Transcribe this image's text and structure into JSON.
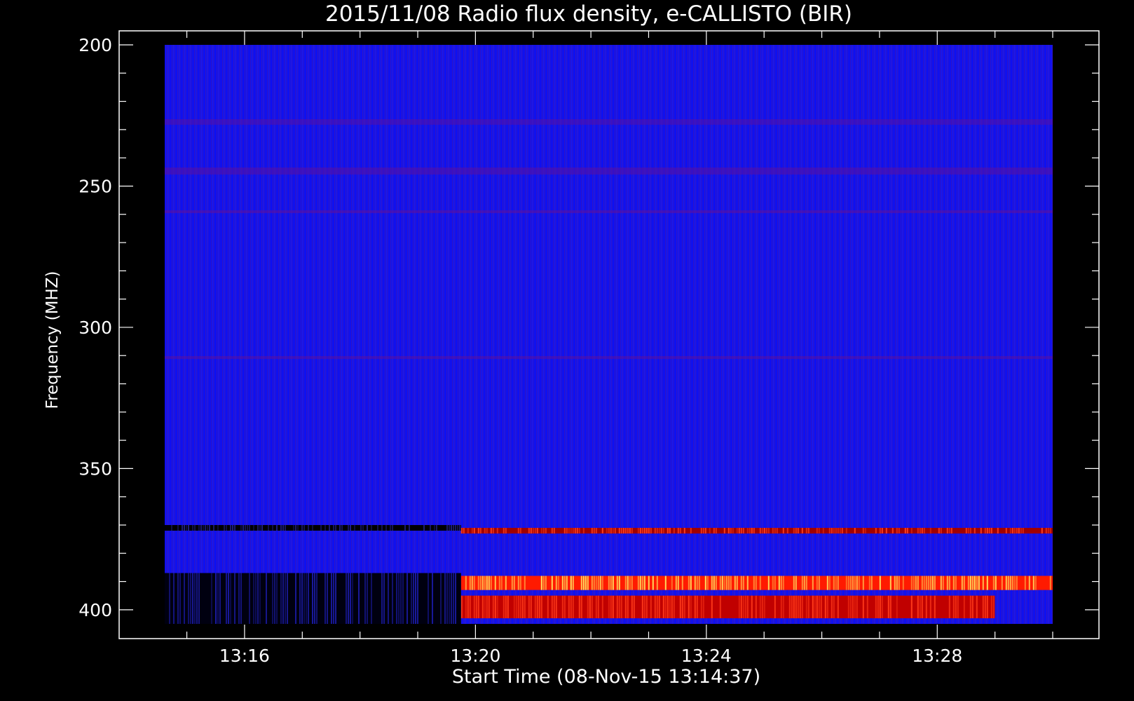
{
  "chart_data": {
    "type": "heatmap",
    "title": "2015/11/08  Radio flux density, e-CALLISTO (BIR)",
    "xlabel": "Start Time (08-Nov-15 13:14:37)",
    "ylabel": "Frequency (MHZ)",
    "x_ticks": [
      "13:16",
      "13:20",
      "13:24",
      "13:28"
    ],
    "y_ticks": [
      "200",
      "250",
      "300",
      "350",
      "400"
    ],
    "x_range": [
      "13:14:37",
      "13:30:00"
    ],
    "ylim": [
      200,
      405
    ],
    "y_axis_inverted": true,
    "colormap": [
      "#000000",
      "#0000ff",
      "#ff0000",
      "#ffff66"
    ],
    "background_color": "#1414e6",
    "features": [
      {
        "type": "emission band",
        "freq": [
          388,
          393
        ],
        "time": [
          "13:19:45",
          "13:30:00"
        ],
        "intensity": "high"
      },
      {
        "type": "emission band",
        "freq": [
          395,
          403
        ],
        "time": [
          "13:19:45",
          "13:29:00"
        ],
        "intensity": "medium"
      },
      {
        "type": "emission line",
        "freq": [
          371,
          373
        ],
        "time": [
          "13:19:45",
          "13:30:00"
        ],
        "intensity": "medium"
      },
      {
        "type": "absorption band",
        "freq": [
          387,
          405
        ],
        "time": [
          "13:14:37",
          "13:19:45"
        ],
        "intensity": "low"
      },
      {
        "type": "absorption line",
        "freq": [
          370,
          372
        ],
        "time": [
          "13:14:37",
          "13:19:45"
        ],
        "intensity": "low"
      }
    ]
  }
}
